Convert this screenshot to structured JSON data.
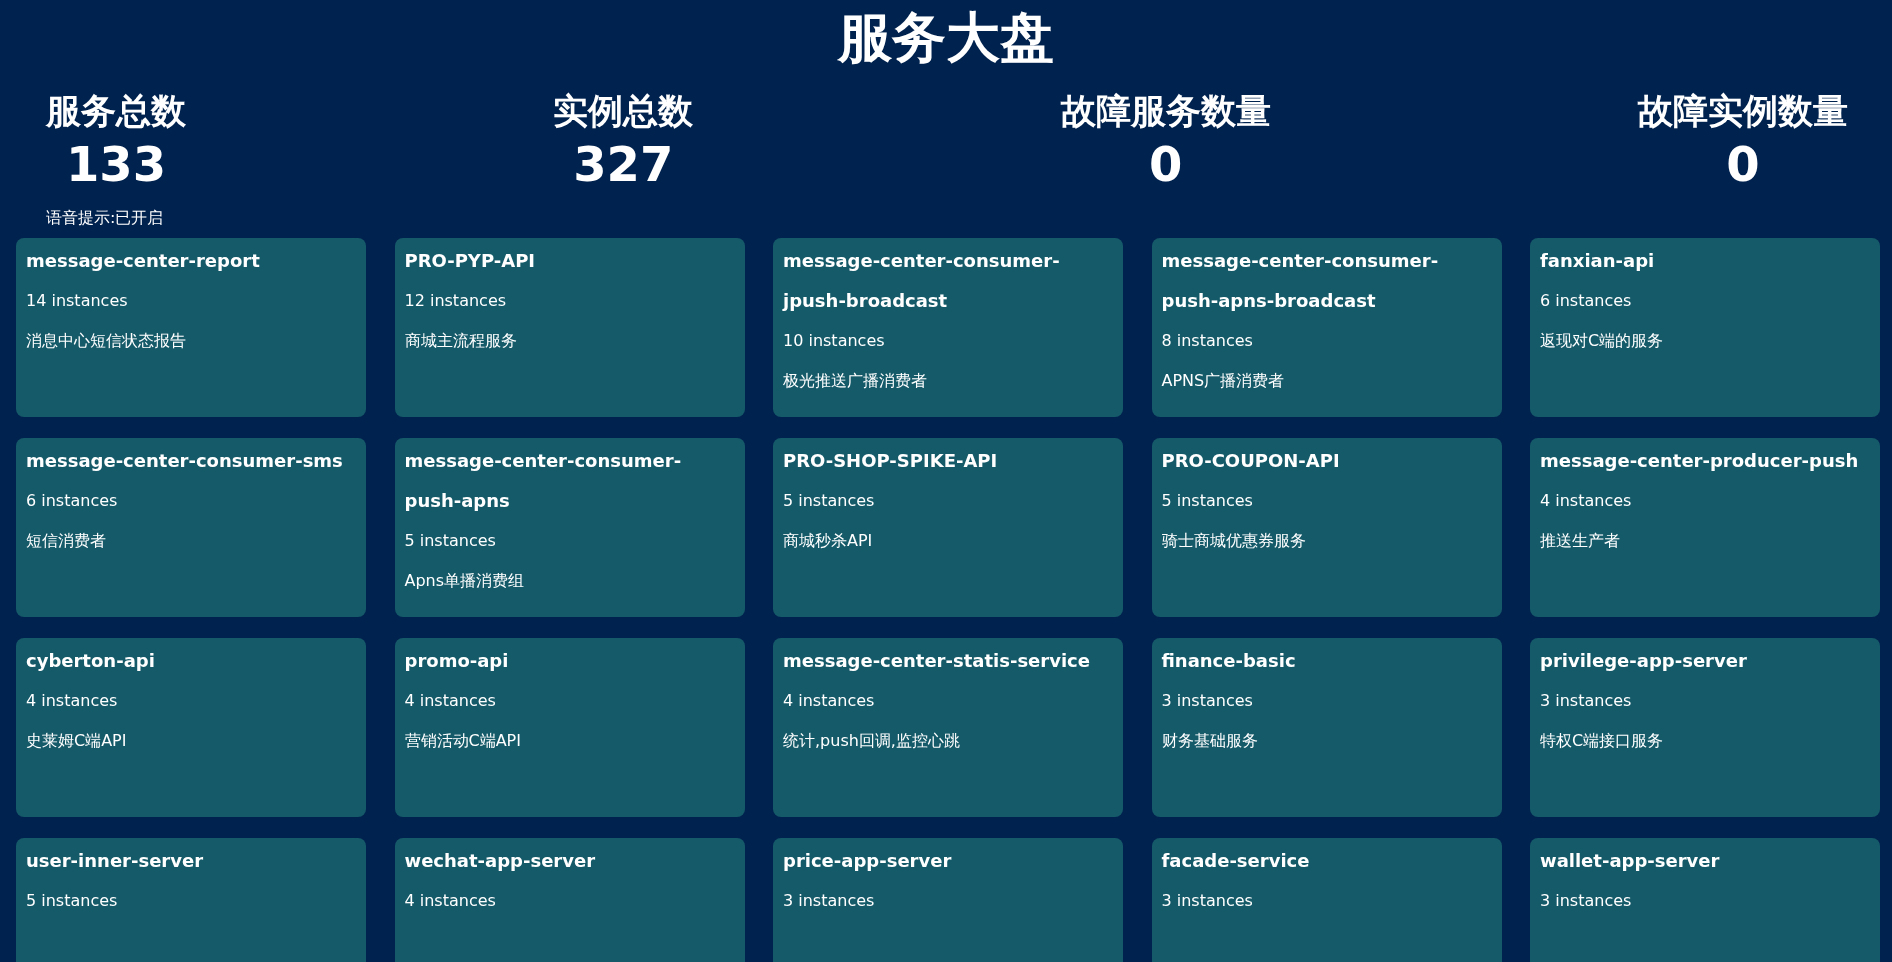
{
  "title": "服务大盘",
  "stats": [
    {
      "label": "服务总数",
      "value": "133"
    },
    {
      "label": "实例总数",
      "value": "327"
    },
    {
      "label": "故障服务数量",
      "value": "0"
    },
    {
      "label": "故障实例数量",
      "value": "0"
    }
  ],
  "voice_hint": "语音提示:已开启",
  "services": [
    {
      "name": "message-center-report",
      "instances": "14 instances",
      "description": "消息中心短信状态报告"
    },
    {
      "name": "PRO-PYP-API",
      "instances": "12 instances",
      "description": "商城主流程服务"
    },
    {
      "name": "message-center-consumer-jpush-broadcast",
      "instances": "10 instances",
      "description": "极光推送广播消费者"
    },
    {
      "name": "message-center-consumer-push-apns-broadcast",
      "instances": "8 instances",
      "description": "APNS广播消费者"
    },
    {
      "name": "fanxian-api",
      "instances": "6 instances",
      "description": "返现对C端的服务"
    },
    {
      "name": "message-center-consumer-sms",
      "instances": "6 instances",
      "description": "短信消费者"
    },
    {
      "name": "message-center-consumer-push-apns",
      "instances": "5 instances",
      "description": "Apns单播消费组"
    },
    {
      "name": "PRO-SHOP-SPIKE-API",
      "instances": "5 instances",
      "description": "商城秒杀API"
    },
    {
      "name": "PRO-COUPON-API",
      "instances": "5 instances",
      "description": "骑士商城优惠券服务"
    },
    {
      "name": "message-center-producer-push",
      "instances": "4 instances",
      "description": "推送生产者"
    },
    {
      "name": "cyberton-api",
      "instances": "4 instances",
      "description": "史莱姆C端API"
    },
    {
      "name": "promo-api",
      "instances": "4 instances",
      "description": "营销活动C端API"
    },
    {
      "name": "message-center-statis-service",
      "instances": "4 instances",
      "description": "统计,push回调,监控心跳"
    },
    {
      "name": "finance-basic",
      "instances": "3 instances",
      "description": "财务基础服务"
    },
    {
      "name": "privilege-app-server",
      "instances": "3 instances",
      "description": "特权C端接口服务"
    },
    {
      "name": "user-inner-server",
      "instances": "5 instances"
    },
    {
      "name": "wechat-app-server",
      "instances": "4 instances"
    },
    {
      "name": "price-app-server",
      "instances": "3 instances"
    },
    {
      "name": "facade-service",
      "instances": "3 instances"
    },
    {
      "name": "wallet-app-server",
      "instances": "3 instances"
    }
  ]
}
